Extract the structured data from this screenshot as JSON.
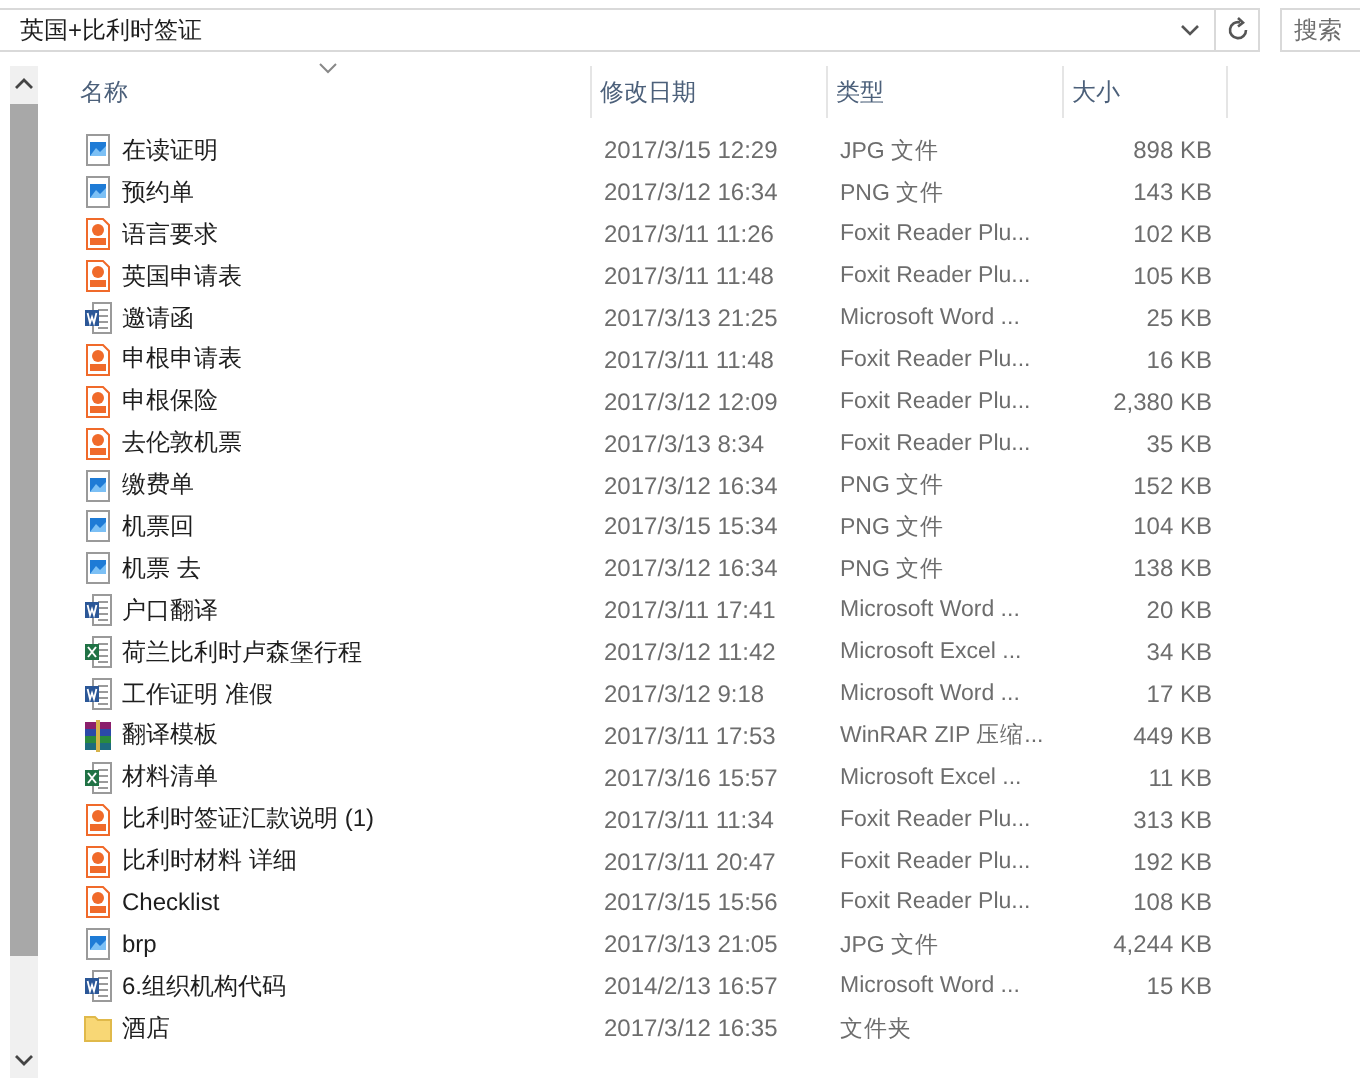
{
  "address_bar": {
    "path": "英国+比利时签证"
  },
  "search": {
    "placeholder": "搜索"
  },
  "columns": [
    {
      "label": "名称",
      "sorted": true
    },
    {
      "label": "修改日期",
      "sorted": false
    },
    {
      "label": "类型",
      "sorted": false
    },
    {
      "label": "大小",
      "sorted": false
    }
  ],
  "files": [
    {
      "kind": "image",
      "name": "在读证明",
      "modified": "2017/3/15 12:29",
      "type": "JPG 文件",
      "size": "898 KB"
    },
    {
      "kind": "image",
      "name": "预约单",
      "modified": "2017/3/12 16:34",
      "type": "PNG 文件",
      "size": "143 KB"
    },
    {
      "kind": "pdf",
      "name": "语言要求",
      "modified": "2017/3/11 11:26",
      "type": "Foxit Reader Plu...",
      "size": "102 KB"
    },
    {
      "kind": "pdf",
      "name": "英国申请表",
      "modified": "2017/3/11 11:48",
      "type": "Foxit Reader Plu...",
      "size": "105 KB"
    },
    {
      "kind": "word",
      "name": "邀请函",
      "modified": "2017/3/13 21:25",
      "type": "Microsoft Word ...",
      "size": "25 KB"
    },
    {
      "kind": "pdf",
      "name": "申根申请表",
      "modified": "2017/3/11 11:48",
      "type": "Foxit Reader Plu...",
      "size": "16 KB"
    },
    {
      "kind": "pdf",
      "name": "申根保险",
      "modified": "2017/3/12 12:09",
      "type": "Foxit Reader Plu...",
      "size": "2,380 KB"
    },
    {
      "kind": "pdf",
      "name": "去伦敦机票",
      "modified": "2017/3/13 8:34",
      "type": "Foxit Reader Plu...",
      "size": "35 KB"
    },
    {
      "kind": "image",
      "name": "缴费单",
      "modified": "2017/3/12 16:34",
      "type": "PNG 文件",
      "size": "152 KB"
    },
    {
      "kind": "image",
      "name": "机票回",
      "modified": "2017/3/15 15:34",
      "type": "PNG 文件",
      "size": "104 KB"
    },
    {
      "kind": "image",
      "name": "机票 去",
      "modified": "2017/3/12 16:34",
      "type": "PNG 文件",
      "size": "138 KB"
    },
    {
      "kind": "word",
      "name": "户口翻译",
      "modified": "2017/3/11 17:41",
      "type": "Microsoft Word ...",
      "size": "20 KB"
    },
    {
      "kind": "excel",
      "name": "荷兰比利时卢森堡行程",
      "modified": "2017/3/12 11:42",
      "type": "Microsoft Excel ...",
      "size": "34 KB"
    },
    {
      "kind": "word",
      "name": "工作证明 准假",
      "modified": "2017/3/12 9:18",
      "type": "Microsoft Word ...",
      "size": "17 KB"
    },
    {
      "kind": "archive",
      "name": "翻译模板",
      "modified": "2017/3/11 17:53",
      "type": "WinRAR ZIP 压缩...",
      "size": "449 KB"
    },
    {
      "kind": "excel",
      "name": "材料清单",
      "modified": "2017/3/16 15:57",
      "type": "Microsoft Excel ...",
      "size": "11 KB"
    },
    {
      "kind": "pdf",
      "name": "比利时签证汇款说明 (1)",
      "modified": "2017/3/11 11:34",
      "type": "Foxit Reader Plu...",
      "size": "313 KB"
    },
    {
      "kind": "pdf",
      "name": "比利时材料 详细",
      "modified": "2017/3/11 20:47",
      "type": "Foxit Reader Plu...",
      "size": "192 KB"
    },
    {
      "kind": "pdf",
      "name": "Checklist",
      "modified": "2017/3/15 15:56",
      "type": "Foxit Reader Plu...",
      "size": "108 KB"
    },
    {
      "kind": "image",
      "name": "brp",
      "modified": "2017/3/13 21:05",
      "type": "JPG 文件",
      "size": "4,244 KB"
    },
    {
      "kind": "word",
      "name": "6.组织机构代码",
      "modified": "2014/2/13 16:57",
      "type": "Microsoft Word ...",
      "size": "15 KB"
    },
    {
      "kind": "folder",
      "name": "酒店",
      "modified": "2017/3/12 16:35",
      "type": "文件夹"
    }
  ]
}
